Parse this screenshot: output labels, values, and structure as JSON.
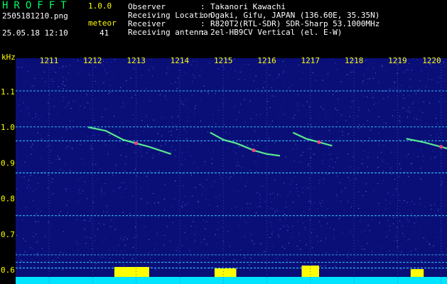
{
  "header": {
    "title": "HROFFT",
    "version": "1.0.0",
    "filename": "2505181210.png",
    "meteor_label": "meteor",
    "datetime": "25.05.18 12:10",
    "meteor_count": "41",
    "info": [
      {
        "label": "Observer",
        "value": "Takanori Kawachi"
      },
      {
        "label": "Receiving Location",
        "value": "Ogaki, Gifu, JAPAN (136.60E, 35.35N)"
      },
      {
        "label": "Receiver",
        "value": "R820T2(RTL-SDR) SDR-Sharp 53.1000MHz"
      },
      {
        "label": "Receiving antenna",
        "value": "2el-HB9CV Vertical (el. E-W)"
      }
    ]
  },
  "spectrogram": {
    "y_unit": "kHz",
    "x_ticks": [
      "1211",
      "1212",
      "1213",
      "1214",
      "1215",
      "1216",
      "1217",
      "1218",
      "1219",
      "1220"
    ],
    "y_ticks": [
      "1.1",
      "1.0",
      "0.9",
      "0.8",
      "0.7",
      "0.6"
    ],
    "colors": {
      "background": "#0a0f78",
      "label": "#ffff00",
      "level": "#00e5ff",
      "signal": "#ffff00"
    }
  }
}
